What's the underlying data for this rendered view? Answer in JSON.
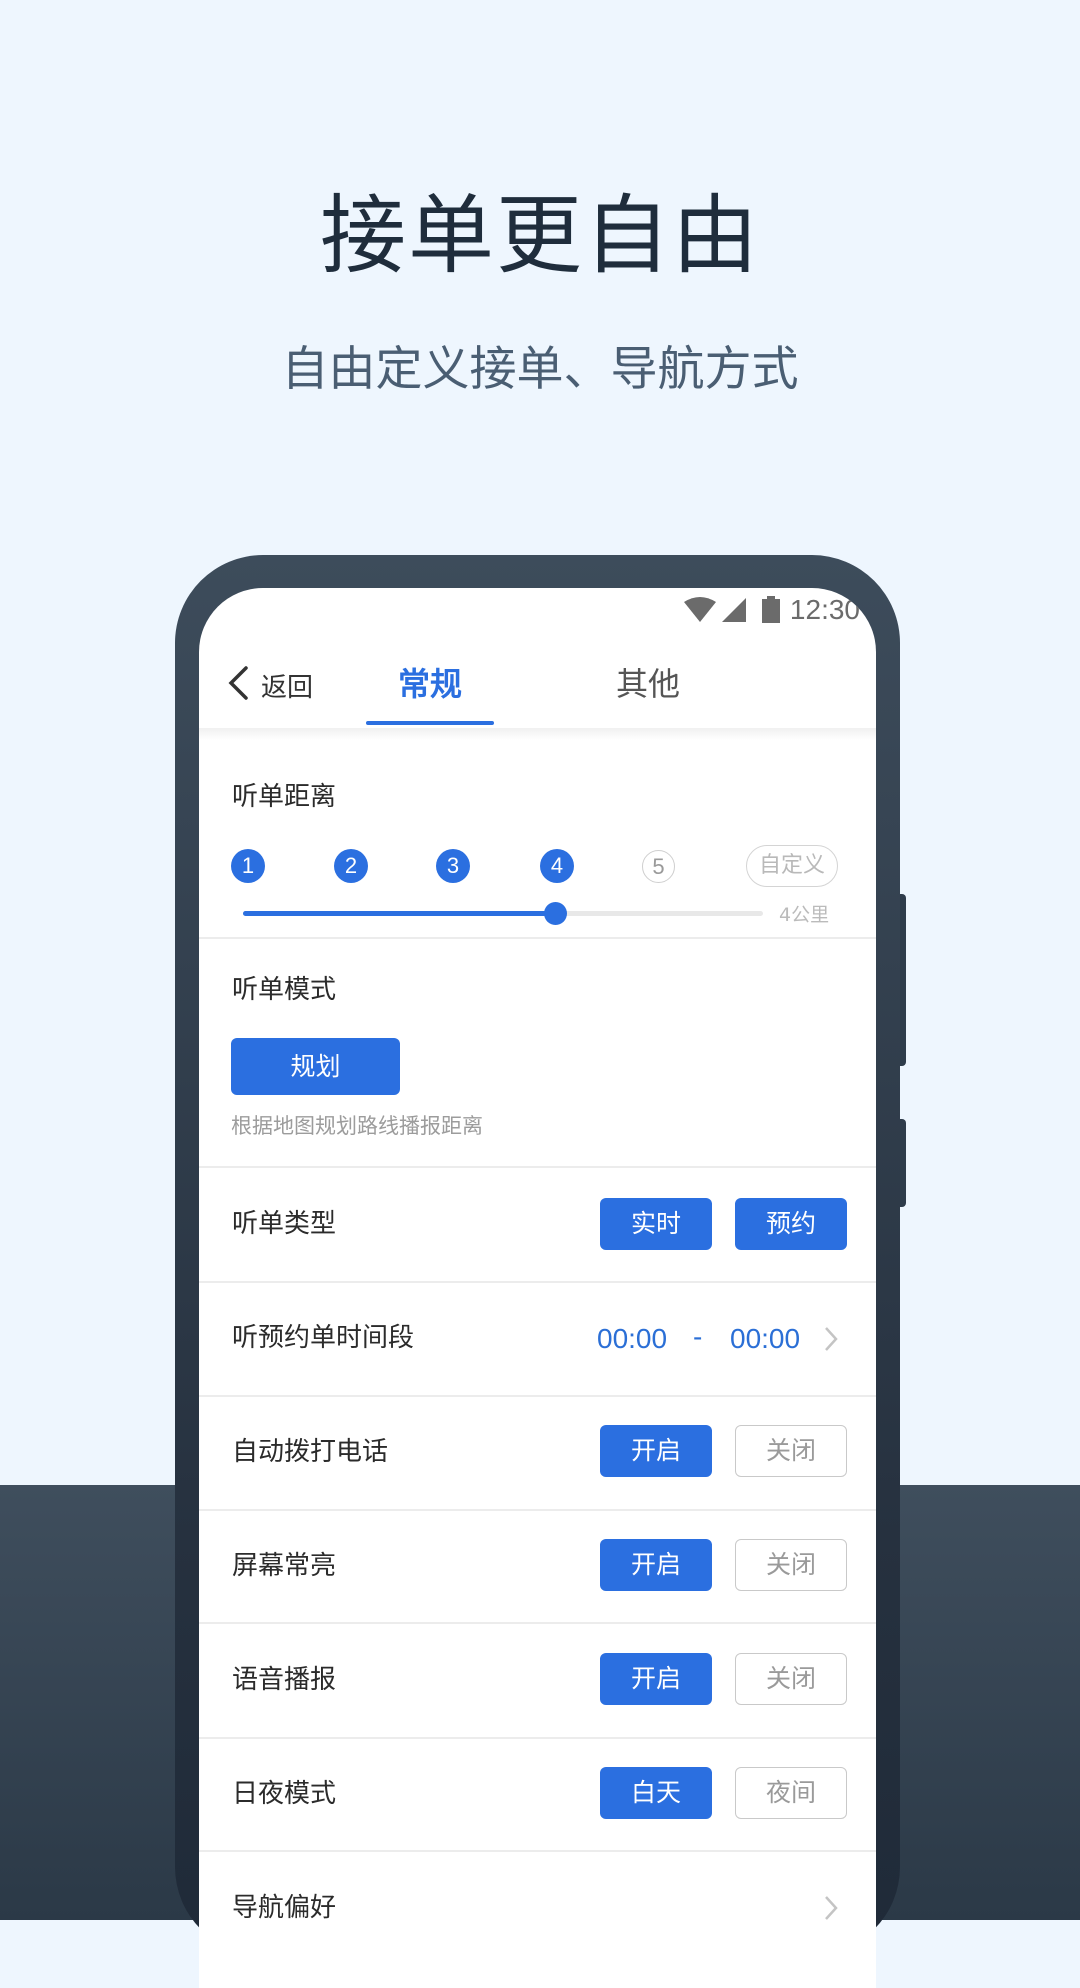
{
  "hero": {
    "title": "接单更自由",
    "subtitle": "自由定义接单、导航方式"
  },
  "colors": {
    "accent": "#2b6fe0",
    "background_top": "#eef6fe",
    "background_bottom": "#3f4e5d",
    "frame": "#3d4c5b"
  },
  "status_bar": {
    "icons": [
      "wifi-icon",
      "signal-icon",
      "battery-icon"
    ],
    "time": "12:30"
  },
  "header": {
    "back_label": "返回",
    "tabs": [
      {
        "label": "常规",
        "active": true
      },
      {
        "label": "其他",
        "active": false
      }
    ]
  },
  "distance": {
    "label": "听单距离",
    "steps": [
      "1",
      "2",
      "3",
      "4",
      "5"
    ],
    "selected_step": 4,
    "custom_label": "自定义",
    "slider_value_fraction": 0.6,
    "value_label": "4公里"
  },
  "mode": {
    "label": "听单模式",
    "button_label": "规划",
    "hint": "根据地图规划路线播报距离"
  },
  "rows": [
    {
      "label": "听单类型",
      "options": [
        {
          "label": "实时",
          "selected": true
        },
        {
          "label": "预约",
          "selected": true
        }
      ]
    },
    {
      "label": "听预约单时间段",
      "time_start": "00:00",
      "separator": "-",
      "time_end": "00:00"
    },
    {
      "label": "自动拨打电话",
      "options": [
        {
          "label": "开启",
          "selected": true
        },
        {
          "label": "关闭",
          "selected": false
        }
      ]
    },
    {
      "label": "屏幕常亮",
      "options": [
        {
          "label": "开启",
          "selected": true
        },
        {
          "label": "关闭",
          "selected": false
        }
      ]
    },
    {
      "label": "语音播报",
      "options": [
        {
          "label": "开启",
          "selected": true
        },
        {
          "label": "关闭",
          "selected": false
        }
      ]
    },
    {
      "label": "日夜模式",
      "options": [
        {
          "label": "白天",
          "selected": true
        },
        {
          "label": "夜间",
          "selected": false
        }
      ]
    },
    {
      "label": "导航偏好"
    }
  ]
}
